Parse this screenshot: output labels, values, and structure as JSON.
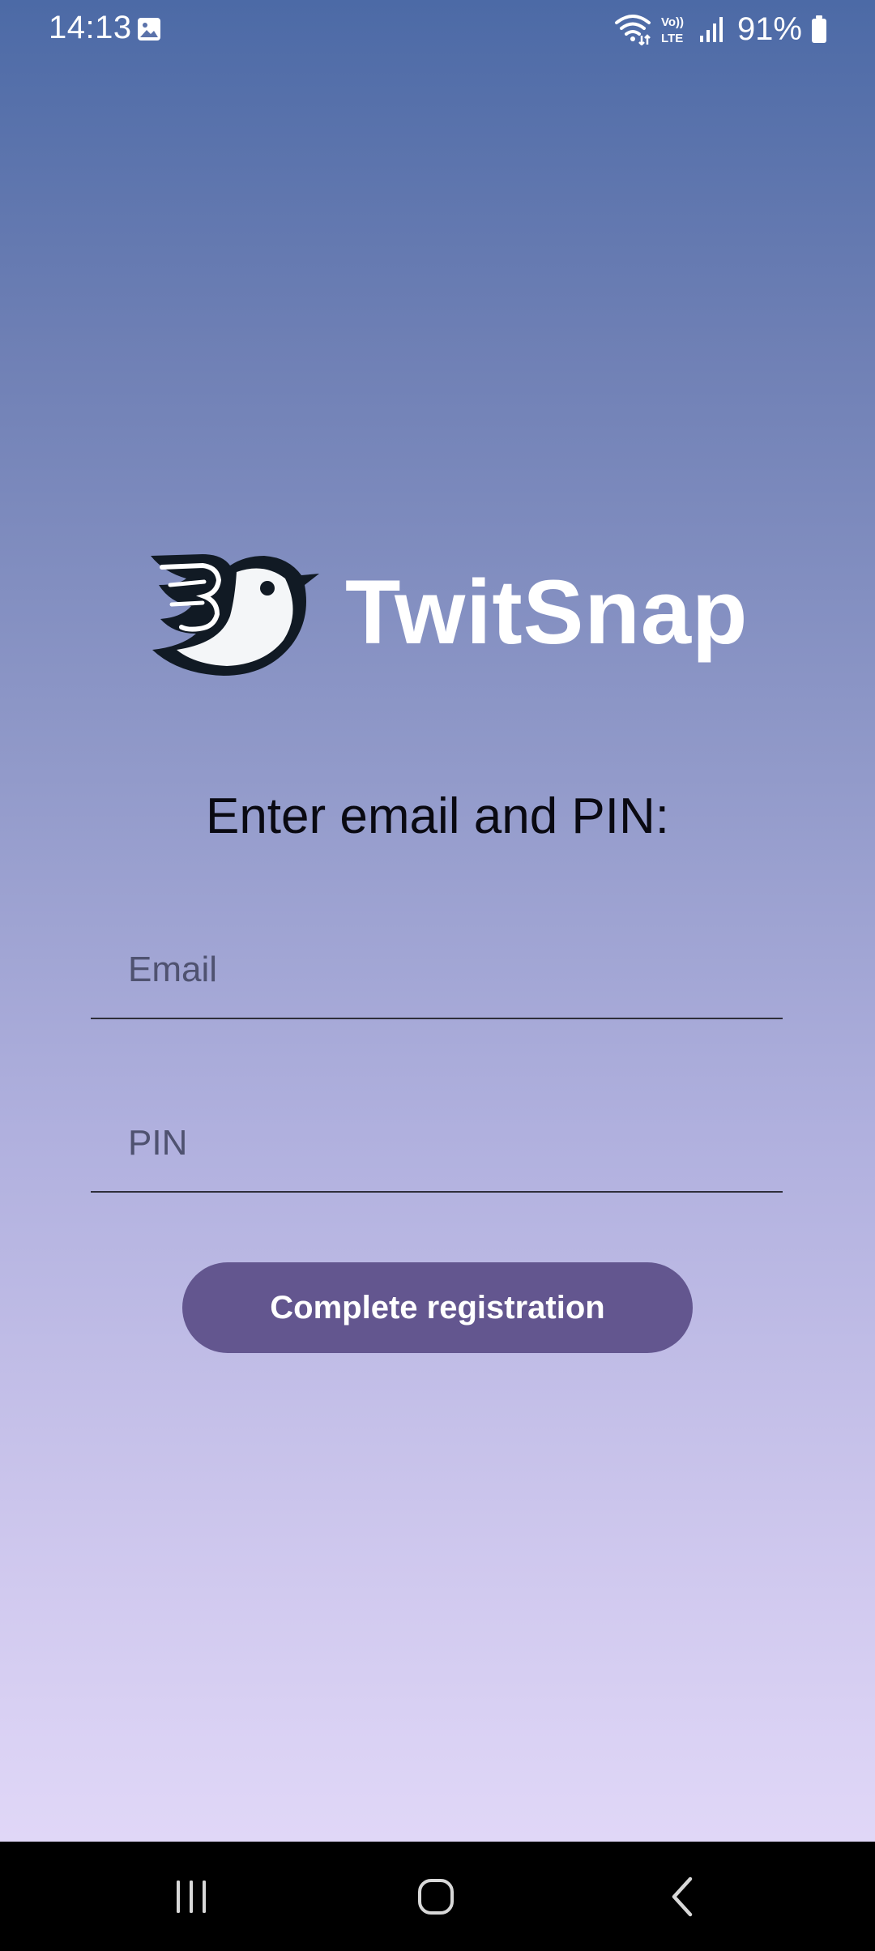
{
  "status_bar": {
    "time": "14:13",
    "battery": "91%",
    "network_label": "Vo)) LTE",
    "icons": [
      "gallery-icon",
      "wifi-icon",
      "volte-icon",
      "signal-icon",
      "battery-icon"
    ]
  },
  "app": {
    "title": "TwitSnap",
    "logo_icon": "bird-logo-icon"
  },
  "form": {
    "prompt": "Enter email and PIN:",
    "email_placeholder": "Email",
    "email_value": "",
    "pin_placeholder": "PIN",
    "pin_value": "",
    "submit_label": "Complete registration"
  },
  "nav_bar": {
    "icons": [
      "recents-icon",
      "home-icon",
      "back-icon"
    ]
  },
  "colors": {
    "gradient_top": "#4c6aa6",
    "gradient_bottom": "#e7ddfb",
    "button": "#63568f",
    "title": "#ffffff"
  }
}
